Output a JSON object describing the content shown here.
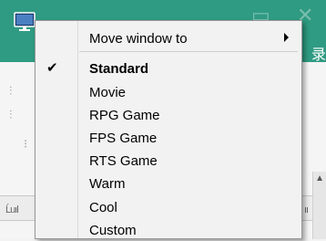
{
  "background_window": {
    "title_color": "#2f9b82",
    "login_text": "录",
    "app_icon": "monitor-icon"
  },
  "menu": {
    "items": [
      {
        "label": "Move window to",
        "has_submenu": true,
        "checked": false
      },
      {
        "label": "Standard",
        "checked": true
      },
      {
        "label": "Movie",
        "checked": false
      },
      {
        "label": "RPG Game",
        "checked": false
      },
      {
        "label": "FPS Game",
        "checked": false
      },
      {
        "label": "RTS Game",
        "checked": false
      },
      {
        "label": "Warm",
        "checked": false
      },
      {
        "label": "Cool",
        "checked": false
      },
      {
        "label": "Custom",
        "checked": false
      }
    ],
    "check_glyph": "✔"
  }
}
